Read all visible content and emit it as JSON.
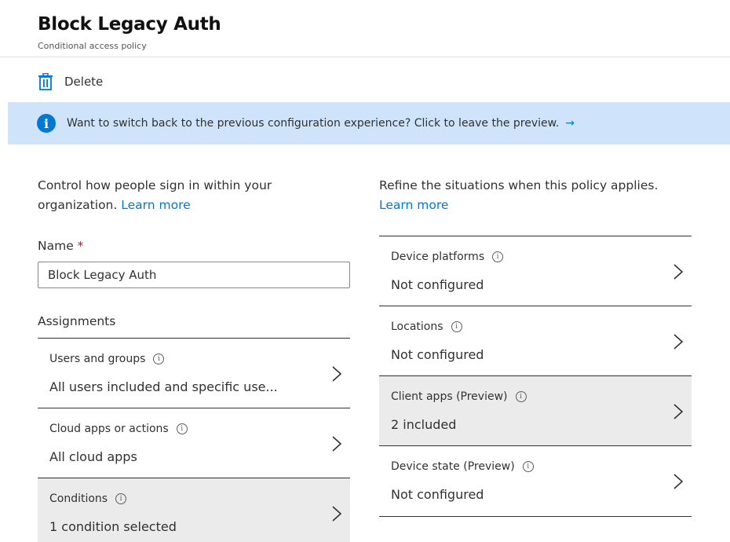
{
  "header": {
    "title": "Block Legacy Auth",
    "subtitle": "Conditional access policy"
  },
  "toolbar": {
    "delete_label": "Delete"
  },
  "banner": {
    "message": "Want to switch back to the previous configuration experience? Click to leave the preview.",
    "arrow": "→"
  },
  "left": {
    "intro": "Control how people sign in within your organization.",
    "learn_more": "Learn more",
    "name_label": "Name",
    "required_mark": "*",
    "name_value": "Block Legacy Auth",
    "assignments_label": "Assignments",
    "rows": [
      {
        "title": "Users and groups",
        "value": "All users included and specific use..."
      },
      {
        "title": "Cloud apps or actions",
        "value": "All cloud apps"
      },
      {
        "title": "Conditions",
        "value": "1 condition selected"
      }
    ]
  },
  "right": {
    "intro": "Refine the situations when this policy applies.",
    "learn_more": "Learn more",
    "rows": [
      {
        "title": "Device platforms",
        "value": "Not configured"
      },
      {
        "title": "Locations",
        "value": "Not configured"
      },
      {
        "title": "Client apps (Preview)",
        "value": "2 included"
      },
      {
        "title": "Device state (Preview)",
        "value": "Not configured"
      }
    ]
  },
  "icons": {
    "info_glyph": "i",
    "row_info_glyph": "i"
  },
  "colors": {
    "accent": "#0078d4",
    "banner_bg": "#cfe4fa",
    "selected_row_bg": "#ebebeb",
    "required": "#a4262c"
  }
}
